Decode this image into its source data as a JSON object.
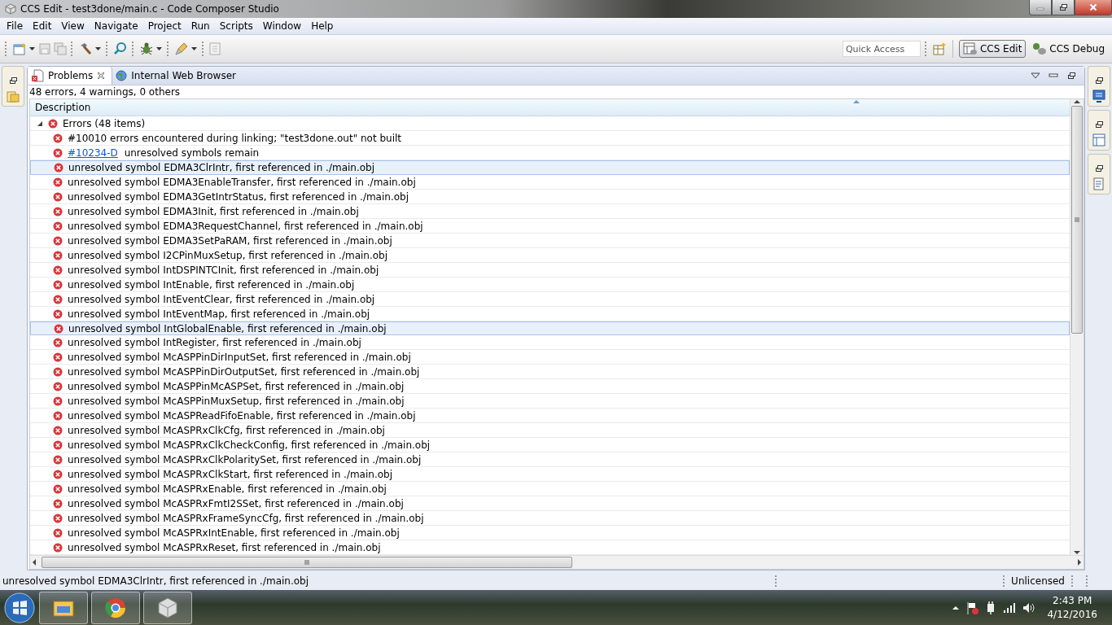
{
  "window": {
    "title": "CCS Edit - test3done/main.c - Code Composer Studio"
  },
  "menu": [
    "File",
    "Edit",
    "View",
    "Navigate",
    "Project",
    "Run",
    "Scripts",
    "Window",
    "Help"
  ],
  "quick_access": {
    "placeholder": "Quick Access"
  },
  "perspectives": [
    {
      "label": "CCS Edit",
      "selected": true
    },
    {
      "label": "CCS Debug",
      "selected": false
    }
  ],
  "view_tabs": [
    {
      "label": "Problems",
      "selected": true
    },
    {
      "label": "Internal Web Browser",
      "selected": false
    }
  ],
  "summary": "48 errors, 4 warnings, 0 others",
  "table": {
    "columns": [
      "Description"
    ],
    "groups": [
      {
        "label": "Errors (48 items)",
        "expanded": true,
        "children": [
          {
            "text": "#10010 errors encountered during linking; \"test3done.out\" not built",
            "selected": false
          },
          {
            "link": "#10234-D",
            "text": "unresolved symbols remain",
            "selected": false
          },
          {
            "text": "unresolved symbol EDMA3ClrIntr, first referenced in ./main.obj",
            "selected": true
          },
          {
            "text": "unresolved symbol EDMA3EnableTransfer, first referenced in ./main.obj",
            "selected": false
          },
          {
            "text": "unresolved symbol EDMA3GetIntrStatus, first referenced in ./main.obj",
            "selected": false
          },
          {
            "text": "unresolved symbol EDMA3Init, first referenced in ./main.obj",
            "selected": false
          },
          {
            "text": "unresolved symbol EDMA3RequestChannel, first referenced in ./main.obj",
            "selected": false
          },
          {
            "text": "unresolved symbol EDMA3SetPaRAM, first referenced in ./main.obj",
            "selected": false
          },
          {
            "text": "unresolved symbol I2CPinMuxSetup, first referenced in ./main.obj",
            "selected": false
          },
          {
            "text": "unresolved symbol IntDSPINTCInit, first referenced in ./main.obj",
            "selected": false
          },
          {
            "text": "unresolved symbol IntEnable, first referenced in ./main.obj",
            "selected": false
          },
          {
            "text": "unresolved symbol IntEventClear, first referenced in ./main.obj",
            "selected": false
          },
          {
            "text": "unresolved symbol IntEventMap, first referenced in ./main.obj",
            "selected": false
          },
          {
            "text": "unresolved symbol IntGlobalEnable, first referenced in ./main.obj",
            "selected": true
          },
          {
            "text": "unresolved symbol IntRegister, first referenced in ./main.obj",
            "selected": false
          },
          {
            "text": "unresolved symbol McASPPinDirInputSet, first referenced in ./main.obj",
            "selected": false
          },
          {
            "text": "unresolved symbol McASPPinDirOutputSet, first referenced in ./main.obj",
            "selected": false
          },
          {
            "text": "unresolved symbol McASPPinMcASPSet, first referenced in ./main.obj",
            "selected": false
          },
          {
            "text": "unresolved symbol McASPPinMuxSetup, first referenced in ./main.obj",
            "selected": false
          },
          {
            "text": "unresolved symbol McASPReadFifoEnable, first referenced in ./main.obj",
            "selected": false
          },
          {
            "text": "unresolved symbol McASPRxClkCfg, first referenced in ./main.obj",
            "selected": false
          },
          {
            "text": "unresolved symbol McASPRxClkCheckConfig, first referenced in ./main.obj",
            "selected": false
          },
          {
            "text": "unresolved symbol McASPRxClkPolaritySet, first referenced in ./main.obj",
            "selected": false
          },
          {
            "text": "unresolved symbol McASPRxClkStart, first referenced in ./main.obj",
            "selected": false
          },
          {
            "text": "unresolved symbol McASPRxEnable, first referenced in ./main.obj",
            "selected": false
          },
          {
            "text": "unresolved symbol McASPRxFmtI2SSet, first referenced in ./main.obj",
            "selected": false
          },
          {
            "text": "unresolved symbol McASPRxFrameSyncCfg, first referenced in ./main.obj",
            "selected": false
          },
          {
            "text": "unresolved symbol McASPRxIntEnable, first referenced in ./main.obj",
            "selected": false
          },
          {
            "text": "unresolved symbol McASPRxReset, first referenced in ./main.obj",
            "selected": false
          }
        ]
      }
    ]
  },
  "status_bar": {
    "message": "unresolved symbol EDMA3ClrIntr, first referenced in ./main.obj",
    "license": "Unlicensed"
  },
  "taskbar": {
    "time": "2:43 PM",
    "date": "4/12/2016"
  }
}
